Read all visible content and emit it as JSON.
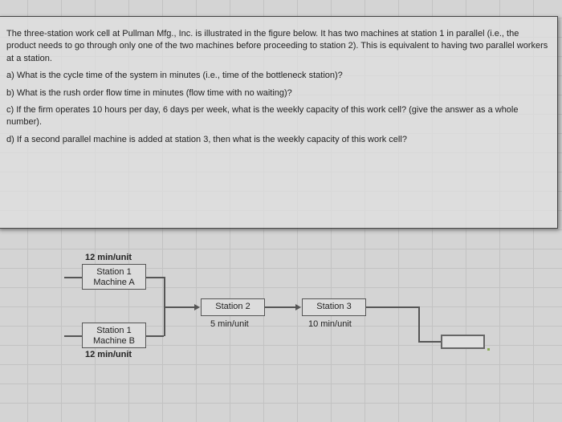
{
  "question": {
    "intro": "The three-station work cell at Pullman Mfg., Inc. is illustrated in the figure below. It has two machines at station 1 in parallel (i.e., the product needs to go through only one of the two machines before proceeding to station 2). This is equivalent to having two parallel workers at a station.",
    "a": "a) What is the cycle time of the system in minutes (i.e., time of the bottleneck station)?",
    "b": "b) What is the rush order flow time in minutes (flow time with no waiting)?",
    "c": "c) If the firm operates 10 hours per day, 6 days per week, what is the weekly capacity of this work cell? (give the answer as a whole number).",
    "d": "d) If a second parallel machine is added at station 3, then what is the weekly capacity of this work cell?"
  },
  "diagram": {
    "station1_a_time": "12 min/unit",
    "station1_a_label": "Station 1\nMachine A",
    "station1_b_label": "Station 1\nMachine B",
    "station1_b_time": "12 min/unit",
    "station2_label": "Station 2",
    "station2_time": "5 min/unit",
    "station3_label": "Station 3",
    "station3_time": "10 min/unit"
  }
}
